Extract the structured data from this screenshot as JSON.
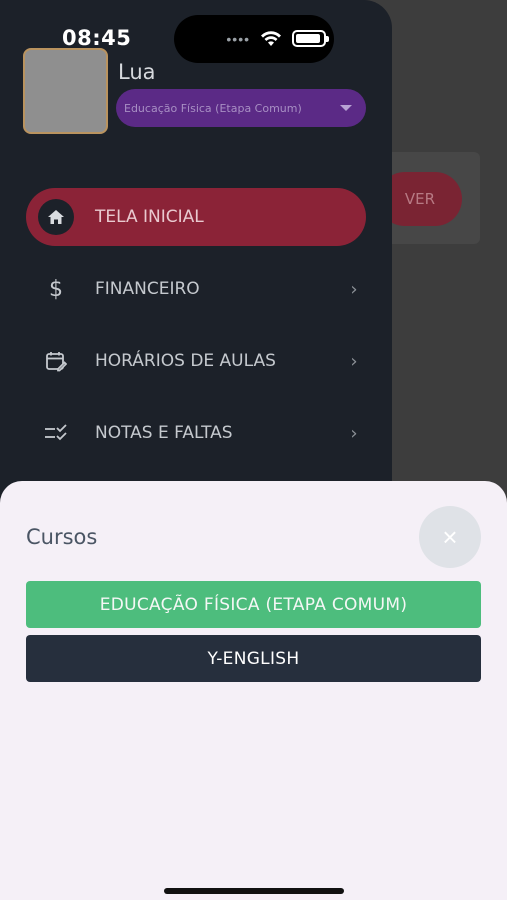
{
  "status": {
    "time": "08:45"
  },
  "background": {
    "ver_button_label": "VER"
  },
  "drawer": {
    "user_name": "Lua",
    "course_select_value": "Educação Física (Etapa Comum)",
    "menu": [
      {
        "label": "TELA INICIAL",
        "icon": "home-icon",
        "active": true
      },
      {
        "label": "FINANCEIRO",
        "icon": "dollar-icon"
      },
      {
        "label": "HORÁRIOS DE AULAS",
        "icon": "calendar-edit-icon"
      },
      {
        "label": "NOTAS E FALTAS",
        "icon": "checklist-icon"
      }
    ]
  },
  "sheet": {
    "title": "Cursos",
    "close_symbol": "×",
    "courses": [
      {
        "label": "EDUCAÇÃO FÍSICA (ETAPA COMUM)",
        "color": "#4dbd7d"
      },
      {
        "label": "Y-ENGLISH",
        "color": "#262f3d"
      }
    ]
  },
  "colors": {
    "active_menu": "#8b2337",
    "course_select": "#5b2a86",
    "drawer_bg": "#1c2129",
    "sheet_bg": "#f5f0f7"
  }
}
